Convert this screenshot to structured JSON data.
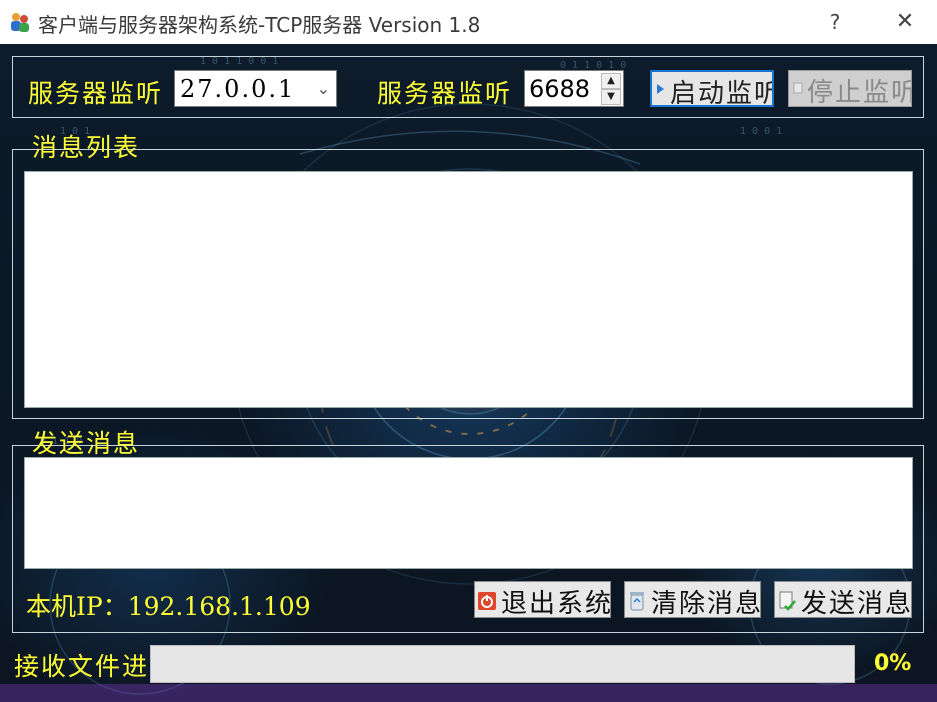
{
  "window": {
    "title": "客户端与服务器架构系统-TCP服务器 Version 1.8",
    "help_glyph": "?",
    "close_glyph": "✕",
    "icon": "users-app-icon"
  },
  "listen": {
    "ip_label": "服务器监听",
    "ip_value": "27.0.0.1",
    "port_label": "服务器监听",
    "port_value": "6688",
    "start_label": "启动监听",
    "stop_label": "停止监听"
  },
  "messages": {
    "caption": "消息列表",
    "items": []
  },
  "send": {
    "caption": "发送消息",
    "text": ""
  },
  "local": {
    "ip_label": "本机IP：192.168.1.109"
  },
  "actions": {
    "exit_label": "退出系统",
    "clear_label": "清除消息",
    "send_label": "发送消息"
  },
  "receive": {
    "label": "接收文件进度",
    "progress_percent": 0,
    "percent_text": "0%"
  },
  "colors": {
    "label_yellow": "#ffff33",
    "focus_blue": "#1b74d1",
    "progress_green": "#06b025"
  }
}
